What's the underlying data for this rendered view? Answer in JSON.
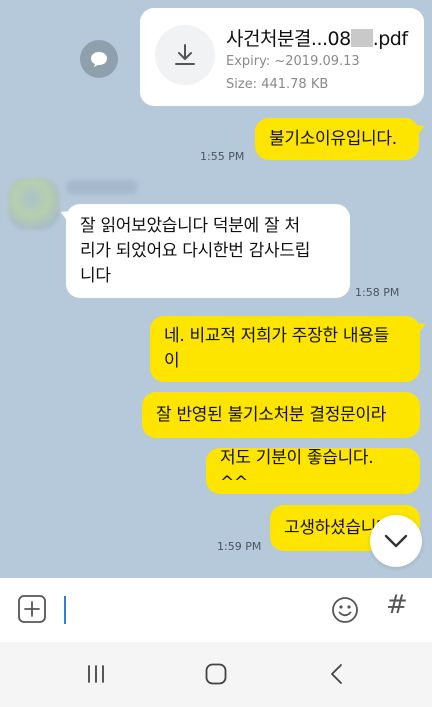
{
  "file_message": {
    "file_name_start": "사건처분결...08",
    "file_name_end": ".pdf",
    "expiry": "Expiry: ~2019.09.13",
    "size": "Size: 441.78 KB"
  },
  "messages": [
    {
      "from": "me",
      "text": "불기소이유입니다.",
      "time": "1:55 PM"
    },
    {
      "from": "other",
      "text": "잘 읽어보았습니다    덕분에 잘 처\n리가 되었어요 다시한번 감사드립\n니다",
      "time": "1:58 PM"
    },
    {
      "from": "me",
      "text": "네. 비교적 저희가 주장한 내용들\n이"
    },
    {
      "from": "me",
      "text": "잘 반영된 불기소처분 결정문이라"
    },
    {
      "from": "me",
      "text": "저도 기분이 좋습니다. ^^"
    },
    {
      "from": "me",
      "text": "고생하셨습니다",
      "time": "1:59 PM"
    }
  ],
  "input": {
    "value": "",
    "placeholder": ""
  },
  "icons": {
    "share": "share-icon",
    "download": "download-icon",
    "scroll_down": "chevron-down-icon",
    "attach": "plus-square-icon",
    "emoji": "emoji-icon",
    "hash": "#",
    "nav_recent": "recent-apps-icon",
    "nav_home": "home-icon",
    "nav_back": "back-icon"
  },
  "colors": {
    "chat_background": "#b6c9db",
    "my_bubble": "#fee500",
    "other_bubble": "#ffffff"
  }
}
